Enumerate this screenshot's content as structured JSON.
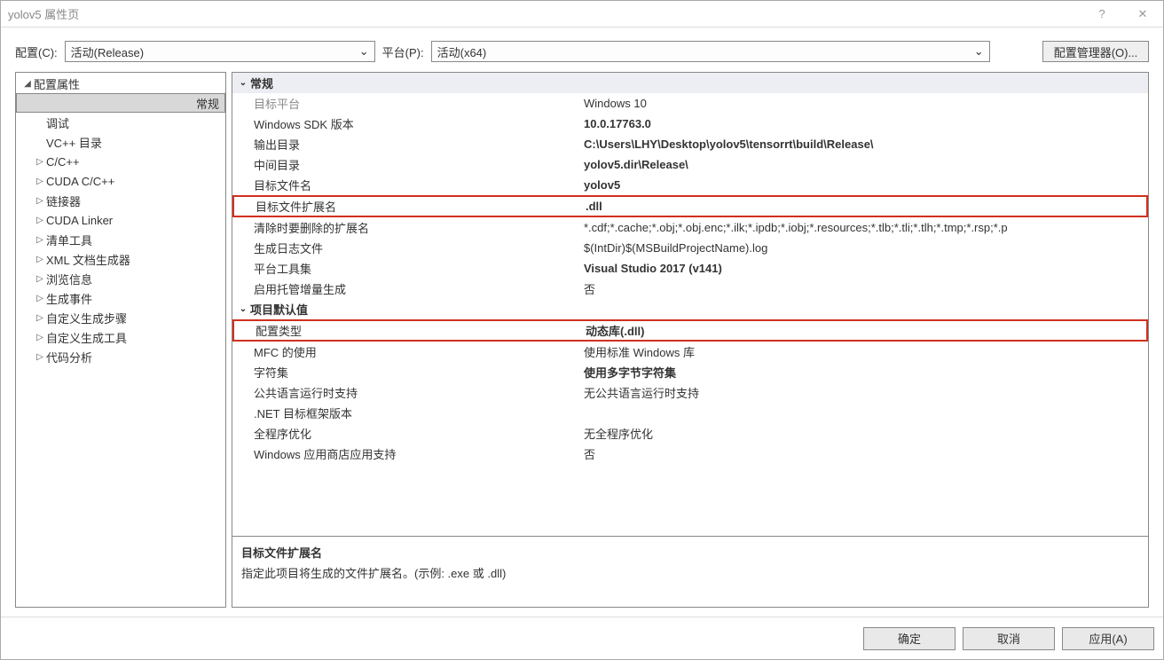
{
  "window": {
    "title": "yolov5 属性页",
    "help": "?",
    "close": "✕"
  },
  "toolbar": {
    "config_label": "配置(C):",
    "config_value": "活动(Release)",
    "platform_label": "平台(P):",
    "platform_value": "活动(x64)",
    "config_manager": "配置管理器(O)..."
  },
  "tree": {
    "root": "配置属性",
    "items": [
      {
        "label": "常规",
        "selected": true,
        "expandable": false
      },
      {
        "label": "调试",
        "expandable": false
      },
      {
        "label": "VC++ 目录",
        "expandable": false
      },
      {
        "label": "C/C++",
        "expandable": true
      },
      {
        "label": "CUDA C/C++",
        "expandable": true
      },
      {
        "label": "链接器",
        "expandable": true
      },
      {
        "label": "CUDA Linker",
        "expandable": true
      },
      {
        "label": "清单工具",
        "expandable": true
      },
      {
        "label": "XML 文档生成器",
        "expandable": true
      },
      {
        "label": "浏览信息",
        "expandable": true
      },
      {
        "label": "生成事件",
        "expandable": true
      },
      {
        "label": "自定义生成步骤",
        "expandable": true
      },
      {
        "label": "自定义生成工具",
        "expandable": true
      },
      {
        "label": "代码分析",
        "expandable": true
      }
    ]
  },
  "props": {
    "sections": [
      {
        "header": "常规",
        "selected_header": true,
        "rows": [
          {
            "label": "目标平台",
            "value": "Windows 10",
            "labelGray": true
          },
          {
            "label": "Windows SDK 版本",
            "value": "10.0.17763.0",
            "bold": true
          },
          {
            "label": "输出目录",
            "value": "C:\\Users\\LHY\\Desktop\\yolov5\\tensorrt\\build\\Release\\",
            "bold": true
          },
          {
            "label": "中间目录",
            "value": "yolov5.dir\\Release\\",
            "bold": true
          },
          {
            "label": "目标文件名",
            "value": "yolov5",
            "bold": true
          },
          {
            "label": "目标文件扩展名",
            "value": ".dll",
            "bold": true,
            "highlight": true
          },
          {
            "label": "清除时要删除的扩展名",
            "value": "*.cdf;*.cache;*.obj;*.obj.enc;*.ilk;*.ipdb;*.iobj;*.resources;*.tlb;*.tli;*.tlh;*.tmp;*.rsp;*.p"
          },
          {
            "label": "生成日志文件",
            "value": "$(IntDir)$(MSBuildProjectName).log"
          },
          {
            "label": "平台工具集",
            "value": "Visual Studio 2017 (v141)",
            "bold": true
          },
          {
            "label": "启用托管增量生成",
            "value": "否"
          }
        ]
      },
      {
        "header": "项目默认值",
        "rows": [
          {
            "label": "配置类型",
            "value": "动态库(.dll)",
            "bold": true,
            "highlight": true
          },
          {
            "label": "MFC 的使用",
            "value": "使用标准 Windows 库"
          },
          {
            "label": "字符集",
            "value": "使用多字节字符集",
            "bold": true
          },
          {
            "label": "公共语言运行时支持",
            "value": "无公共语言运行时支持"
          },
          {
            "label": ".NET 目标框架版本",
            "value": ""
          },
          {
            "label": "全程序优化",
            "value": "无全程序优化"
          },
          {
            "label": "Windows 应用商店应用支持",
            "value": "否"
          }
        ]
      }
    ],
    "desc": {
      "title": "目标文件扩展名",
      "text": "指定此项目将生成的文件扩展名。(示例: .exe 或 .dll)"
    }
  },
  "footer": {
    "ok": "确定",
    "cancel": "取消",
    "apply": "应用(A)"
  }
}
